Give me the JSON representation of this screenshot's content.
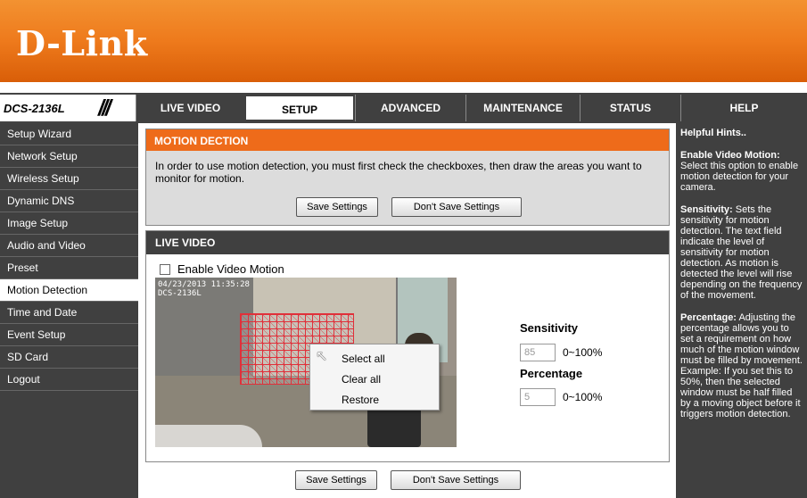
{
  "brand": {
    "logo": "D-Link"
  },
  "model": {
    "name": "DCS-2136L",
    "slash": "///"
  },
  "tabs": [
    {
      "label": "LIVE VIDEO"
    },
    {
      "label": "SETUP"
    },
    {
      "label": "ADVANCED"
    },
    {
      "label": "MAINTENANCE"
    },
    {
      "label": "STATUS"
    },
    {
      "label": "HELP"
    }
  ],
  "active_tab": "SETUP",
  "sidebar": {
    "items": [
      "Setup Wizard",
      "Network Setup",
      "Wireless Setup",
      "Dynamic DNS",
      "Image Setup",
      "Audio and Video",
      "Preset",
      "Motion Detection",
      "Time and Date",
      "Event Setup",
      "SD Card",
      "Logout"
    ],
    "active": "Motion Detection"
  },
  "motion": {
    "title": "MOTION DECTION",
    "description": "In order to use motion detection, you must first check the checkboxes, then draw the areas you want to monitor for motion.",
    "save_label": "Save Settings",
    "dont_save_label": "Don't Save Settings"
  },
  "live": {
    "title": "LIVE VIDEO",
    "enable_label": "Enable Video Motion",
    "enable_checked": false,
    "timestamp_line1": "04/23/2013 11:35:28",
    "timestamp_line2": "DCS-2136L",
    "sensitivity_label": "Sensitivity",
    "sensitivity_value": "85",
    "sensitivity_range": "0~100%",
    "percentage_label": "Percentage",
    "percentage_value": "5",
    "percentage_range": "0~100%",
    "context_menu": [
      "Select all",
      "Clear all",
      "Restore"
    ]
  },
  "footer": {
    "save_label": "Save Settings",
    "dont_save_label": "Don't Save Settings"
  },
  "hints": {
    "title": "Helpful Hints..",
    "items": [
      {
        "heading": "Enable Video Motion:",
        "text": "Select this option to enable motion detection for your camera."
      },
      {
        "heading": "Sensitivity:",
        "text": "Sets the sensitivity for motion detection. The text field indicate the level of sensitivity for motion detection. As motion is detected the level will rise depending on the frequency of the movement."
      },
      {
        "heading": "Percentage:",
        "text": "Adjusting the percentage allows you to set a requirement on how much of the motion window must be filled by movement. Example: If you set this to 50%, then the selected window must be half filled by a moving object before it triggers motion detection."
      }
    ]
  },
  "colors": {
    "accent": "#ee6b1a",
    "nav": "#404040",
    "grid": "#e0303a"
  }
}
